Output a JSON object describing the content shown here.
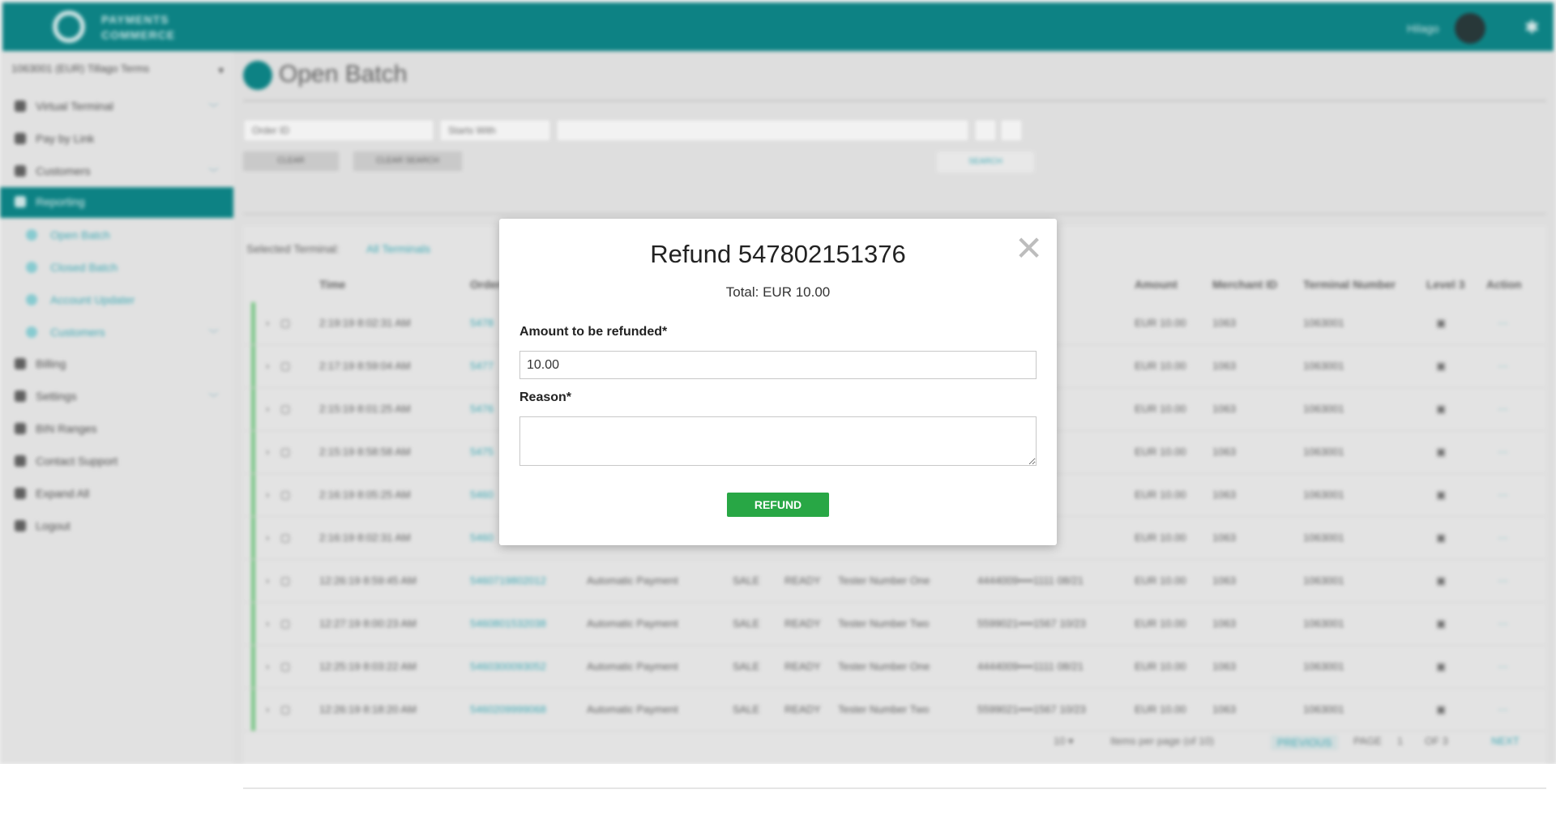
{
  "app": {
    "logo_text": "PAYMENTS COMMERCE",
    "user_name": "Hilago",
    "icons": {
      "user": "avatar-icon",
      "settings": "gear-icon"
    }
  },
  "sidebar": {
    "terminal_select": "1063001 (EUR) Tillago Terms",
    "items": [
      {
        "label": "Virtual Terminal",
        "icon": "terminal-icon"
      },
      {
        "label": "Pay by Link",
        "icon": "link-icon"
      },
      {
        "label": "Customers",
        "icon": "users-icon"
      },
      {
        "label": "Reporting",
        "icon": "report-icon"
      },
      {
        "label": "Open Batch",
        "icon": "circle-icon"
      },
      {
        "label": "Closed Batch",
        "icon": "circle-icon"
      },
      {
        "label": "Account Updater",
        "icon": "updater-icon"
      },
      {
        "label": "Customers",
        "icon": "customers-icon"
      },
      {
        "label": "Billing",
        "icon": "billing-icon"
      },
      {
        "label": "Settings",
        "icon": "settings-icon"
      },
      {
        "label": "BIN Ranges",
        "icon": "bin-icon"
      },
      {
        "label": "Contact Support",
        "icon": "support-icon"
      },
      {
        "label": "Expand All",
        "icon": "expand-icon"
      },
      {
        "label": "Logout",
        "icon": "logout-icon"
      }
    ]
  },
  "main": {
    "page_title": "Open Batch",
    "filters": {
      "field_select": "Order ID",
      "match_select": "Starts With",
      "clear_button": "CLEAR",
      "clear_search_button": "CLEAR SEARCH",
      "search_button": "SEARCH"
    },
    "selected_terminal_label": "Selected Terminal:",
    "selected_terminal_value": "All Terminals",
    "table": {
      "headers": [
        "Time",
        "Order",
        "Amount",
        "Merchant ID",
        "Terminal Number",
        "Level 3",
        "Action"
      ],
      "rows": [
        {
          "time": "2:19:19 8:02:31 AM",
          "order": "5478",
          "amount": "EUR 10.00",
          "merchant": "1063",
          "terminal": "1063001"
        },
        {
          "time": "2:17:19 8:59:04 AM",
          "order": "5477",
          "amount": "EUR 10.00",
          "merchant": "1063",
          "terminal": "1063001"
        },
        {
          "time": "2:15:19 8:01:25 AM",
          "order": "5476",
          "amount": "EUR 10.00",
          "merchant": "1063",
          "terminal": "1063001"
        },
        {
          "time": "2:15:19 8:58:58 AM",
          "order": "5475",
          "amount": "EUR 10.00",
          "merchant": "1063",
          "terminal": "1063001"
        },
        {
          "time": "2:16:19 8:05:25 AM",
          "order": "5460",
          "amount": "EUR 10.00",
          "merchant": "1063",
          "terminal": "1063001"
        },
        {
          "time": "2:16:19 8:02:31 AM",
          "order": "5460",
          "amount": "EUR 10.00",
          "merchant": "1063",
          "terminal": "1063001"
        },
        {
          "time": "12:26:19 8:59:45 AM",
          "order": "5460719802012",
          "desc": "Automatic Payment",
          "type": "SALE",
          "status": "READY",
          "tender": "Tester Number One",
          "card": "4444009••••1111 08/21",
          "amount": "EUR 10.00",
          "merchant": "1063",
          "terminal": "1063001"
        },
        {
          "time": "12:27:19 8:00:23 AM",
          "order": "5460801532038",
          "desc": "Automatic Payment",
          "type": "SALE",
          "status": "READY",
          "tender": "Tester Number Two",
          "card": "5599021••••1567 10/23",
          "amount": "EUR 10.00",
          "merchant": "1063",
          "terminal": "1063001"
        },
        {
          "time": "12:25:19 8:03:22 AM",
          "order": "5460300093052",
          "desc": "Automatic Payment",
          "type": "SALE",
          "status": "READY",
          "tender": "Tester Number One",
          "card": "4444009••••1111 08/21",
          "amount": "EUR 10.00",
          "merchant": "1063",
          "terminal": "1063001"
        },
        {
          "time": "12:26:19 8:18:20 AM",
          "order": "5460209999068",
          "desc": "Automatic Payment",
          "type": "SALE",
          "status": "READY",
          "tender": "Tester Number Two",
          "card": "5599021••••1567 10/23",
          "amount": "EUR 10.00",
          "merchant": "1063",
          "terminal": "1063001"
        }
      ]
    },
    "pager": {
      "items_per_page": "Items per page (of 10)",
      "previous": "PREVIOUS",
      "page": "PAGE",
      "page_number": "1",
      "of": "OF 3",
      "next": "NEXT"
    }
  },
  "modal": {
    "title": "Refund 547802151376",
    "total": "Total: EUR 10.00",
    "amount_label": "Amount to be refunded*",
    "amount_value": "10.00",
    "reason_label": "Reason*",
    "reason_value": "",
    "refund_button": "REFUND",
    "close_glyph": "✕"
  }
}
